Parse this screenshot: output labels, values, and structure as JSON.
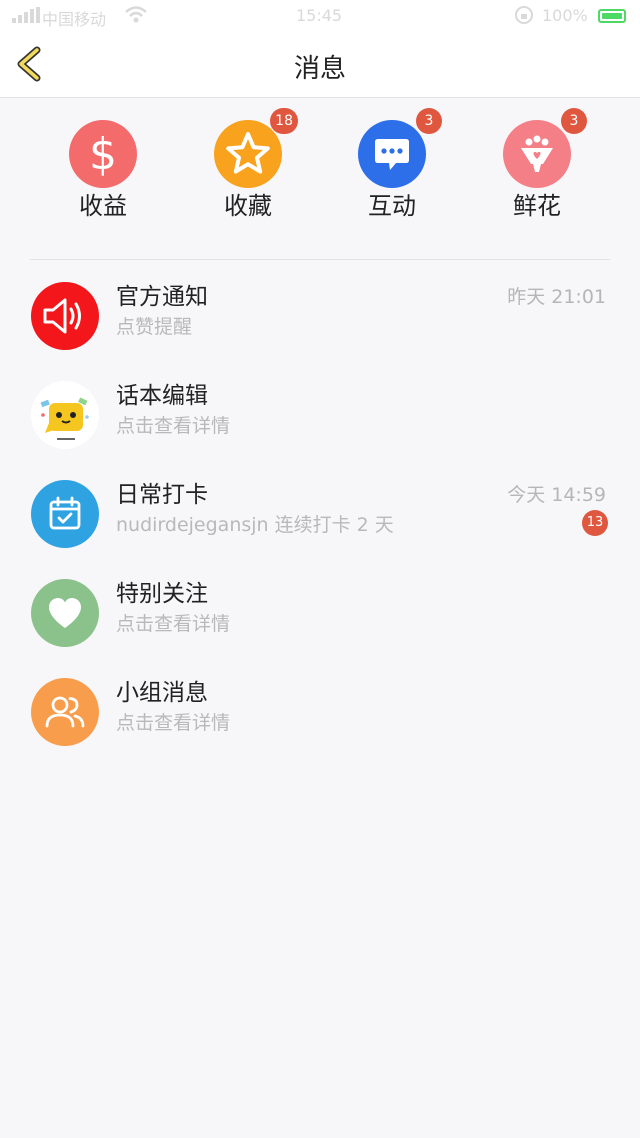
{
  "status_bar": {
    "carrier": "中国移动",
    "time": "15:45",
    "battery": "100%"
  },
  "nav": {
    "title": "消息",
    "back_icon": "chevron-left-icon"
  },
  "quick_actions": [
    {
      "label": "收益",
      "icon": "dollar-icon",
      "color": "#f36b6b",
      "badge": ""
    },
    {
      "label": "收藏",
      "icon": "star-icon",
      "color": "#f8a21d",
      "badge": "18"
    },
    {
      "label": "互动",
      "icon": "chat-icon",
      "color": "#2d6fe8",
      "badge": "3"
    },
    {
      "label": "鲜花",
      "icon": "bouquet-icon",
      "color": "#f47f86",
      "badge": "3"
    }
  ],
  "messages": [
    {
      "title": "官方通知",
      "subtitle": "点赞提醒",
      "time": "昨天 21:01",
      "badge": "",
      "icon": "speaker-icon",
      "color": "#f3161a"
    },
    {
      "title": "话本编辑",
      "subtitle": "点击查看详情",
      "time": "",
      "badge": "",
      "icon": "mascot-avatar-icon",
      "color": "#ffffff"
    },
    {
      "title": "日常打卡",
      "subtitle": "nudirdejegansjn 连续打卡 2 天",
      "time": "今天 14:59",
      "badge": "13",
      "icon": "calendar-check-icon",
      "color": "#2fa3e2"
    },
    {
      "title": "特别关注",
      "subtitle": "点击查看详情",
      "time": "",
      "badge": "",
      "icon": "heart-icon",
      "color": "#8bc28c"
    },
    {
      "title": "小组消息",
      "subtitle": "点击查看详情",
      "time": "",
      "badge": "",
      "icon": "group-icon",
      "color": "#f89d4c"
    }
  ]
}
